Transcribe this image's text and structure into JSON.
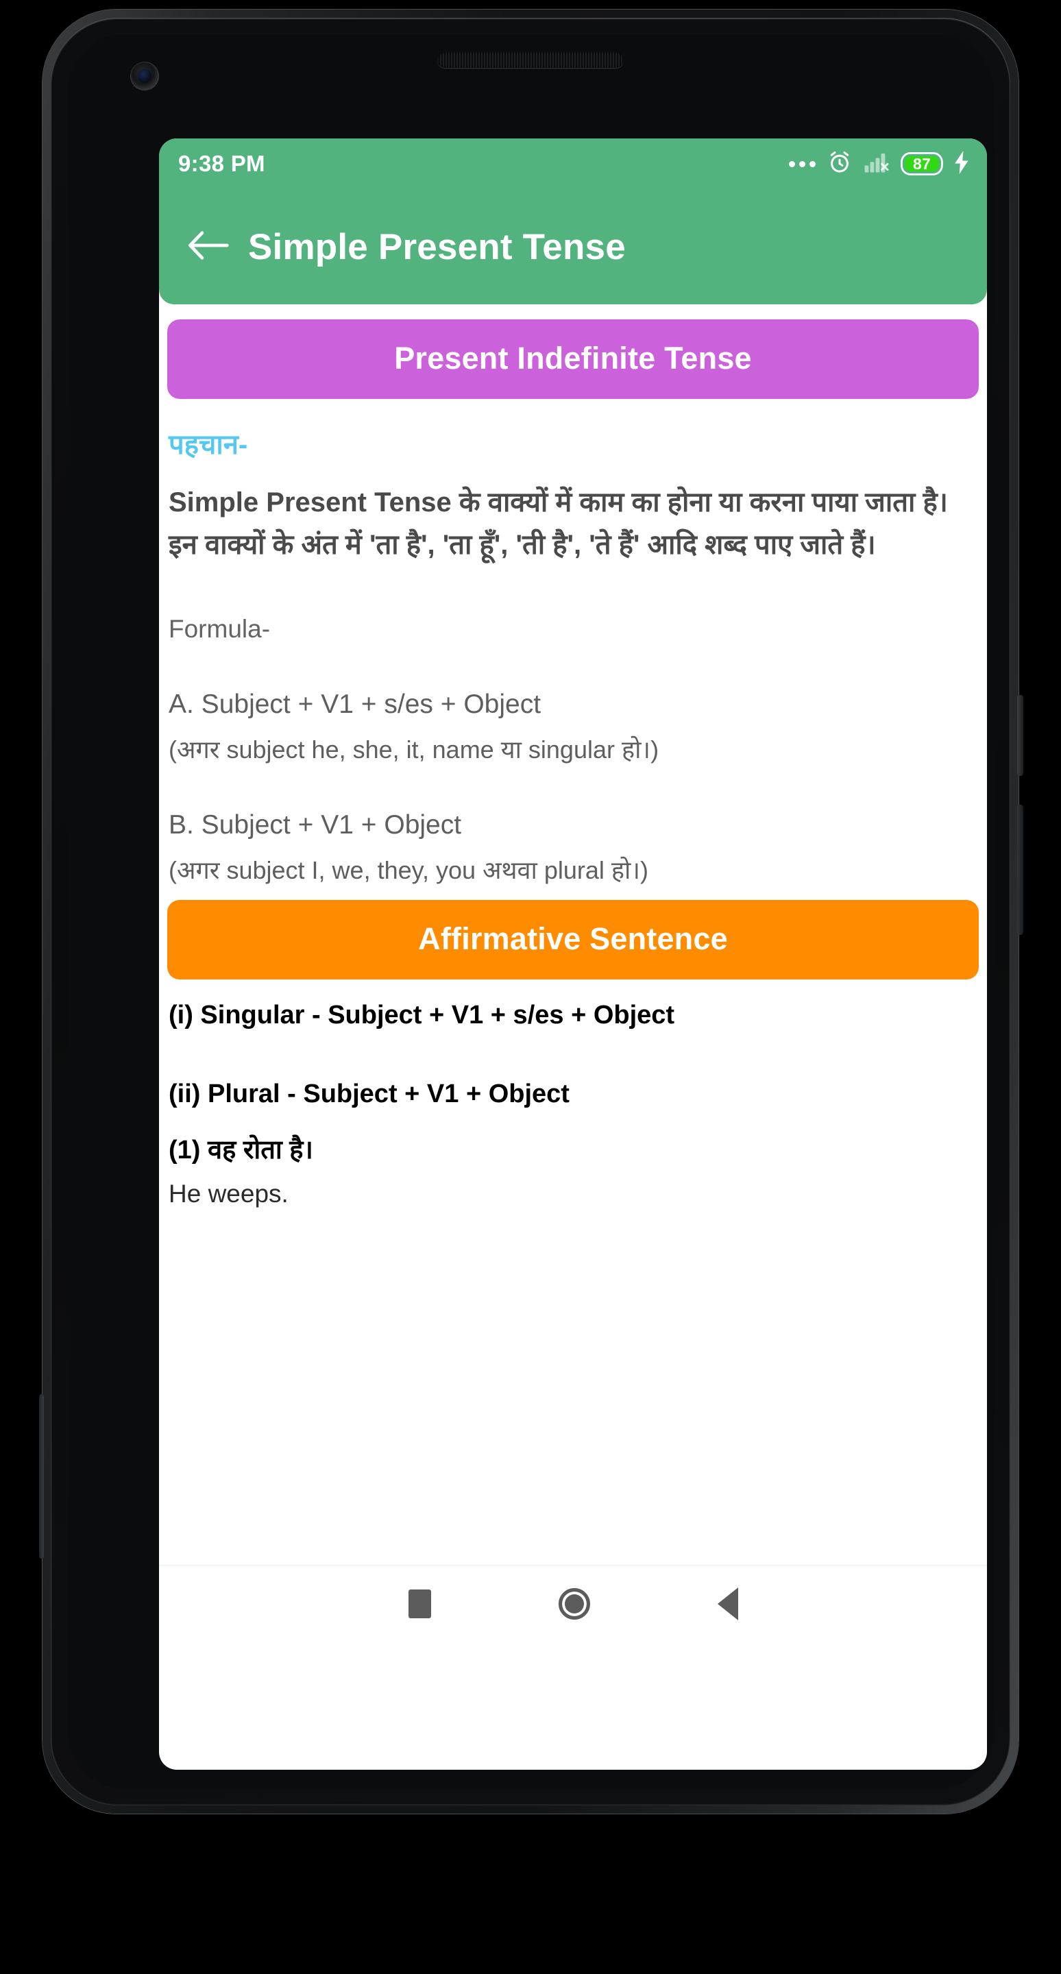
{
  "device": {
    "type": "android-phone",
    "front_camera": "front-camera",
    "earpiece": "earpiece-speaker",
    "bottom_speaker": "bottom-speaker"
  },
  "status_bar": {
    "clock": "9:38 PM",
    "icons": [
      "more-dots-icon",
      "alarm-clock-icon",
      "signal-no-service-icon",
      "battery-icon",
      "charging-bolt-icon"
    ],
    "battery_percent": "87",
    "background_color": "#52b37e",
    "text_color": "#ffffff"
  },
  "app_bar": {
    "back_icon": "back-arrow-icon",
    "title": "Simple Present Tense",
    "background_color": "#52b37e"
  },
  "content": {
    "banner_primary": {
      "label": "Present Indefinite Tense",
      "color": "#cc61dc"
    },
    "heading_identification": "पहचान-",
    "heading_identification_color": "#54c8f0",
    "paragraph_identification": "Simple Present Tense के वाक्यों में काम का होना या करना पाया जाता है। इन वाक्यों के अंत में 'ता है', 'ता हूँ', 'ती है', 'ते हैं' आदि शब्द पाए जाते हैं।",
    "label_formula": "Formula-",
    "formulas": [
      {
        "line": "A. Subject + V1 + s/es + Object",
        "note": "(अगर subject he, she, it, name या singular हो।)"
      },
      {
        "line": "B. Subject + V1 + Object",
        "note": "(अगर subject I, we, they, you अथवा plural हो।)"
      }
    ],
    "banner_affirmative": {
      "label": "Affirmative Sentence",
      "color": "#ff8c00"
    },
    "structures": [
      "(i) Singular - Subject + V1 + s/es + Object",
      "(ii) Plural - Subject + V1 + Object"
    ],
    "examples": [
      {
        "hindi": "(1) वह रोता है।",
        "english": "He weeps."
      }
    ]
  },
  "nav_bar": {
    "items": [
      "recents-button",
      "home-button",
      "back-button"
    ]
  }
}
